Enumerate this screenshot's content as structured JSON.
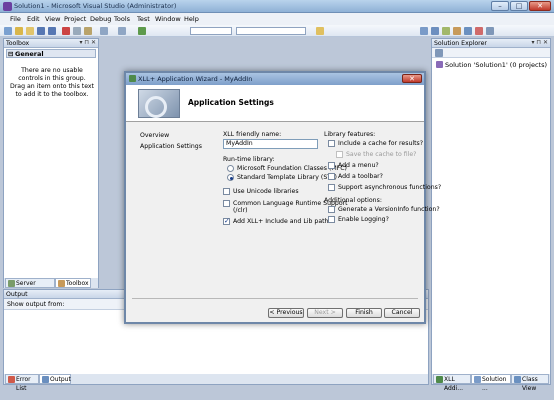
{
  "window": {
    "title": "Solution1 - Microsoft Visual Studio (Administrator)"
  },
  "menu": [
    "File",
    "Edit",
    "View",
    "Project",
    "Debug",
    "Tools",
    "Test",
    "Window",
    "Help"
  ],
  "toolbox": {
    "title": "Toolbox",
    "group": "General",
    "empty_text": "There are no usable controls in this group. Drag an item onto this text to add it to the toolbox.",
    "tabs": [
      "Server Explorer",
      "Toolbox"
    ]
  },
  "output": {
    "title": "Output",
    "show_output_from": "Show output from:",
    "tabs": [
      "Error List",
      "Output"
    ]
  },
  "solution_explorer": {
    "title": "Solution Explorer",
    "root": "Solution 'Solution1' (0 projects)",
    "tabs": [
      "XLL Addi...",
      "Solution ...",
      "Class View"
    ]
  },
  "dialog": {
    "title": "XLL+ Application Wizard - MyAddIn",
    "banner_title": "Application Settings",
    "nav": [
      "Overview",
      "Application Settings"
    ],
    "friendly_name_label": "XLL friendly name:",
    "friendly_name_value": "MyAddIn",
    "runtime_label": "Run-time library:",
    "runtime_options": [
      {
        "label": "Microsoft Foundation Classes (MFC)",
        "checked": false
      },
      {
        "label": "Standard Template Library (STL)",
        "checked": true
      }
    ],
    "left_checks": [
      {
        "label": "Use Unicode libraries",
        "checked": false
      },
      {
        "label": "Common Language Runtime Support",
        "label2": "(/clr)",
        "checked": false
      },
      {
        "label": "Add XLL+ Include and Lib paths?",
        "checked": true
      }
    ],
    "library_features_label": "Library features:",
    "library_features": [
      {
        "label": "Include a cache for results?",
        "checked": false,
        "disabled": false
      },
      {
        "label": "Save the cache to file?",
        "checked": false,
        "disabled": true
      },
      {
        "label": "Add a menu?",
        "checked": false,
        "disabled": false
      },
      {
        "label": "Add a toolbar?",
        "checked": false,
        "disabled": false
      },
      {
        "label": "Support asynchronous functions?",
        "checked": false,
        "disabled": false
      }
    ],
    "additional_label": "Additional options:",
    "additional_options": [
      {
        "label": "Generate a VersionInfo function?",
        "checked": false
      },
      {
        "label": "Enable Logging?",
        "checked": false
      }
    ],
    "buttons": {
      "previous": "< Previous",
      "next": "Next >",
      "finish": "Finish",
      "cancel": "Cancel"
    }
  }
}
